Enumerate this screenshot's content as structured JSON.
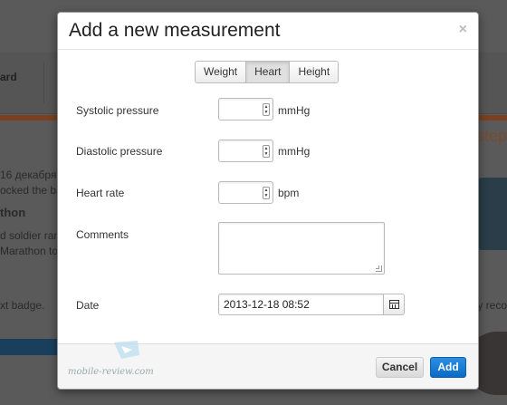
{
  "background": {
    "nav_label": "ard",
    "steps_text": "step",
    "date_line": "16 декабря 2",
    "line2": "ocked the bac",
    "heading": "thon",
    "line3": "d soldier ran fr",
    "line4": "Marathon to A",
    "badge_left": "xt badge.",
    "badge_right": "lly reco"
  },
  "modal": {
    "title": "Add a new measurement",
    "close_label": "×",
    "tabs": [
      {
        "label": "Weight",
        "active": false
      },
      {
        "label": "Heart",
        "active": true
      },
      {
        "label": "Height",
        "active": false
      }
    ],
    "fields": {
      "systolic": {
        "label": "Systolic pressure",
        "value": "",
        "unit": "mmHg"
      },
      "diastolic": {
        "label": "Diastolic pressure",
        "value": "",
        "unit": "mmHg"
      },
      "heart_rate": {
        "label": "Heart rate",
        "value": "",
        "unit": "bpm"
      },
      "comments": {
        "label": "Comments",
        "value": ""
      },
      "date": {
        "label": "Date",
        "value": "2013-12-18 08:52"
      }
    },
    "footer": {
      "cancel_label": "Cancel",
      "add_label": "Add"
    },
    "watermark": "mobile-review.com"
  },
  "colors": {
    "primary_button": "#0a6bc6",
    "accent_strip": "#7d3f22"
  }
}
